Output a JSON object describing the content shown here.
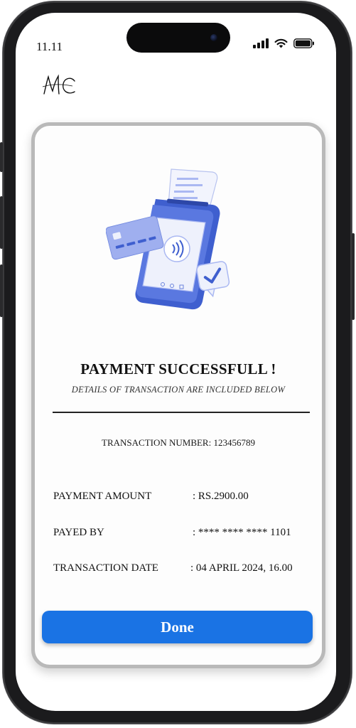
{
  "status_bar": {
    "time": "11.11",
    "icons": [
      "cellular-signal-icon",
      "wifi-icon",
      "battery-icon"
    ]
  },
  "logo": {
    "text": "MC"
  },
  "illustration": {
    "icon": "payment-terminal-illustration"
  },
  "receipt": {
    "title": "PAYMENT SUCCESSFULL !",
    "subtitle": "DETAILS OF TRANSACTION ARE INCLUDED BELOW",
    "transaction_number": "TRANSACTION NUMBER: 123456789",
    "rows": [
      {
        "label": "PAYMENT AMOUNT",
        "value": ": RS.2900.00"
      },
      {
        "label": "PAYED BY",
        "value": ":  **** **** **** 1101"
      },
      {
        "label": "TRANSACTION  DATE",
        "value": ": 04 APRIL 2024, 16.00"
      }
    ],
    "done_label": "Done"
  },
  "colors": {
    "accent": "#1a73e4",
    "illustration_blue": "#3f5fcf",
    "illustration_light": "#aab8f2",
    "card_border": "#b9b9b9"
  }
}
